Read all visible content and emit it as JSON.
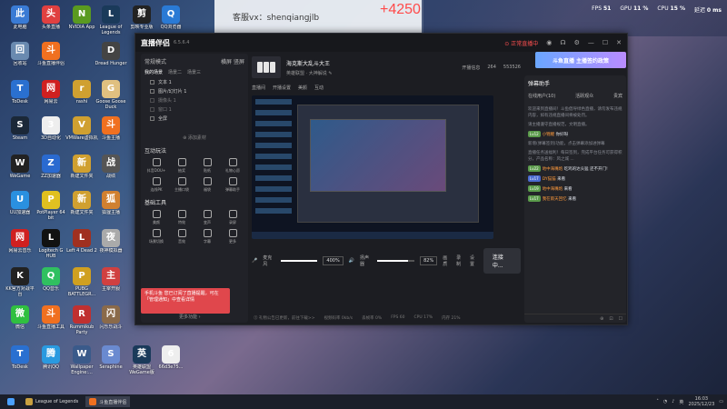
{
  "desktop": {
    "icons": [
      {
        "label": "此电脑",
        "bg": "#3a7bd5",
        "x": 0
      },
      {
        "label": "头条直播",
        "bg": "#e04040",
        "x": 1
      },
      {
        "label": "NVIDIA App",
        "bg": "#5a9a20",
        "x": 2
      },
      {
        "label": "League of Legends",
        "bg": "#1a3a5a",
        "x": 3
      },
      {
        "label": "剪映专业版",
        "bg": "#222",
        "x": 4
      },
      {
        "label": "QQ浏览器",
        "bg": "#2a7ad5",
        "x": 5
      },
      {
        "label": "回收站",
        "bg": "#6a8ab0",
        "x": 0
      },
      {
        "label": "斗鱼直播伴侣",
        "bg": "#f07020",
        "x": 1
      },
      {
        "label": "Dread Hunger",
        "bg": "#444",
        "x": 3
      },
      {
        "label": "ToDesk",
        "bg": "#2a70d0",
        "x": 0
      },
      {
        "label": "网易云",
        "bg": "#d02020",
        "x": 1
      },
      {
        "label": "rashi",
        "bg": "#d0a030",
        "x": 2
      },
      {
        "label": "Goose Goose Duck",
        "bg": "#e0c080",
        "x": 3
      },
      {
        "label": "Steam",
        "bg": "#1b2838",
        "x": 0
      },
      {
        "label": "3D自动化",
        "bg": "#eee",
        "x": 1
      },
      {
        "label": "VMWare虚拟机",
        "bg": "#d0a030",
        "x": 2
      },
      {
        "label": "斗鱼主播",
        "bg": "#f07020",
        "x": 3
      },
      {
        "label": "WeGame",
        "bg": "#222",
        "x": 0
      },
      {
        "label": "ZZ加速器",
        "bg": "#2a6ad0",
        "x": 1
      },
      {
        "label": "新建文件夹",
        "bg": "#d0a030",
        "x": 2
      },
      {
        "label": "战绩",
        "bg": "#555",
        "x": 3
      },
      {
        "label": "UU加速器",
        "bg": "#2a90e0",
        "x": 0
      },
      {
        "label": "PotPlayer 64 bit",
        "bg": "#e0c020",
        "x": 1
      },
      {
        "label": "新建文件夹",
        "bg": "#d0a030",
        "x": 2
      },
      {
        "label": "狐狸主播",
        "bg": "#d08030",
        "x": 3
      },
      {
        "label": "网易云音乐",
        "bg": "#d02020",
        "x": 0
      },
      {
        "label": "Logitech G HUB",
        "bg": "#111",
        "x": 1
      },
      {
        "label": "Left 4 Dead 2",
        "bg": "#a03020",
        "x": 2
      },
      {
        "label": "夜神模拟器",
        "bg": "#aaa",
        "x": 3
      },
      {
        "label": "KK官方对战平台",
        "bg": "#222",
        "x": 0
      },
      {
        "label": "QQ音乐",
        "bg": "#30c060",
        "x": 1
      },
      {
        "label": "PUBG BATTLEGR...",
        "bg": "#d0a020",
        "x": 2
      },
      {
        "label": "主宰开服",
        "bg": "#d04040",
        "x": 3
      },
      {
        "label": "微信",
        "bg": "#30c040",
        "x": 0
      },
      {
        "label": "斗鱼直播工具",
        "bg": "#f07020",
        "x": 1
      },
      {
        "label": "Rummikub Party",
        "bg": "#c03030",
        "x": 2
      },
      {
        "label": "闪乐乐战斗",
        "bg": "#8a6a4a",
        "x": 3
      },
      {
        "label": "ToDesk",
        "bg": "#2a70d0",
        "x": 0
      },
      {
        "label": "腾讯QQ",
        "bg": "#2a9ae0",
        "x": 1
      },
      {
        "label": "Wallpaper Engine:...",
        "bg": "#3a5a8a",
        "x": 2
      },
      {
        "label": "Seraphine",
        "bg": "#6a8ad0",
        "x": 3
      },
      {
        "label": "英雄联盟 WeGame版",
        "bg": "#1a3a5a",
        "x": 4
      },
      {
        "label": "66d3e75...",
        "bg": "#eee",
        "x": 5
      }
    ]
  },
  "overlay": {
    "watermark": "客服vx：shenqiangjlb",
    "gift": "+4250"
  },
  "perf": {
    "fps_label": "FPS",
    "fps": "51",
    "gpu_label": "GPU",
    "gpu": "11 %",
    "cpu_label": "CPU",
    "cpu": "15 %",
    "latency_label": "延迟",
    "latency": "0 ms"
  },
  "app": {
    "name": "直播伴侣",
    "version": "6.5.6.4",
    "live_badge": "⊙ 正常直播中",
    "left": {
      "mode": "常规模式",
      "landscape": "横屏",
      "portrait": "竖屏",
      "tabs": [
        "我的场景",
        "场景二",
        "场景三"
      ],
      "scenes": [
        "文本 1",
        "图片/幻灯片 1",
        "摄像头 1",
        "窗口 1",
        "全屏"
      ],
      "add": "⊕ 添加素材",
      "interact_title": "互动玩法",
      "interact": [
        "抖音DOU+",
        "抽奖",
        "贴纸",
        "礼物心愿",
        "连线PK",
        "主播口袋",
        "福袋",
        "弹幕助手"
      ],
      "tools_title": "基础工具",
      "tools": [
        "美颜",
        "特效",
        "变声",
        "录屏",
        "场景切换",
        "音效",
        "字幕",
        "更多"
      ],
      "more": "更多功能 ›",
      "notice": "手机斗鱼 您已订阅了直播提醒，可在「管理通知」中查看详情"
    },
    "stream": {
      "title": "海克斯大乱斗大王",
      "sub": "英雄联盟 · 大神解说 ✎",
      "stats": [
        "开播信息",
        "264",
        "553526"
      ],
      "bar": [
        "直播间",
        "开播设置",
        "美颜",
        "互动"
      ]
    },
    "controls": {
      "mic": "麦克风",
      "mic_pct": "400%",
      "spk": "扬声器",
      "spk_pct": "82%",
      "icons": [
        "画质",
        "录制",
        "设置"
      ],
      "start": "连接中..."
    },
    "status": [
      "视频码率 0kb/s",
      "丢帧率 0%",
      "FPS 60",
      "CPU 17%",
      "内存 21%",
      "直播时长"
    ],
    "status_tip": "⓵ 礼物公告已更新，前往下载>>",
    "right": {
      "promo": "斗鱼直播 主播签约政策",
      "title": "弹幕助手",
      "tabs": [
        "在线用户(10)",
        "活跃观众",
        "贵宾"
      ],
      "messages": [
        {
          "t": "sys",
          "text": "欢迎来到直播间！斗鱼倡导绿色直播，请勿发布违规内容，如有违规直播间将被处罚。"
        },
        {
          "t": "sys",
          "text": "请主播遵守直播规范，文明直播。"
        },
        {
          "t": "chat",
          "badge": "Lv12",
          "user": "小锦鲤",
          "text": "你好呀"
        },
        {
          "t": "sys",
          "text": "新增(弹幕签到)功能，点击弹幕添加进弹幕"
        },
        {
          "t": "sys",
          "text": "直播任务送福利！每日签到，完成平台任务可获得积分，产品名称：风之城 ..."
        },
        {
          "t": "chat",
          "badge": "Lv22",
          "user": "地中海嘴炮",
          "text": "吃鸡的达头猛 还不开门!"
        },
        {
          "t": "chat",
          "badge": "Lv17",
          "user": "DY猫猫",
          "text": "来看"
        },
        {
          "t": "chat",
          "badge": "Lv19",
          "user": "地中海嘴炮",
          "text": "来看"
        },
        {
          "t": "chat",
          "badge": "Lv17",
          "user": "我在雨天回忆",
          "text": "来看"
        }
      ]
    }
  },
  "taskbar": {
    "items": [
      "League of Legends",
      "斗鱼直播伴侣"
    ],
    "ime": "英",
    "time": "16:03",
    "date": "2025/12/23"
  }
}
